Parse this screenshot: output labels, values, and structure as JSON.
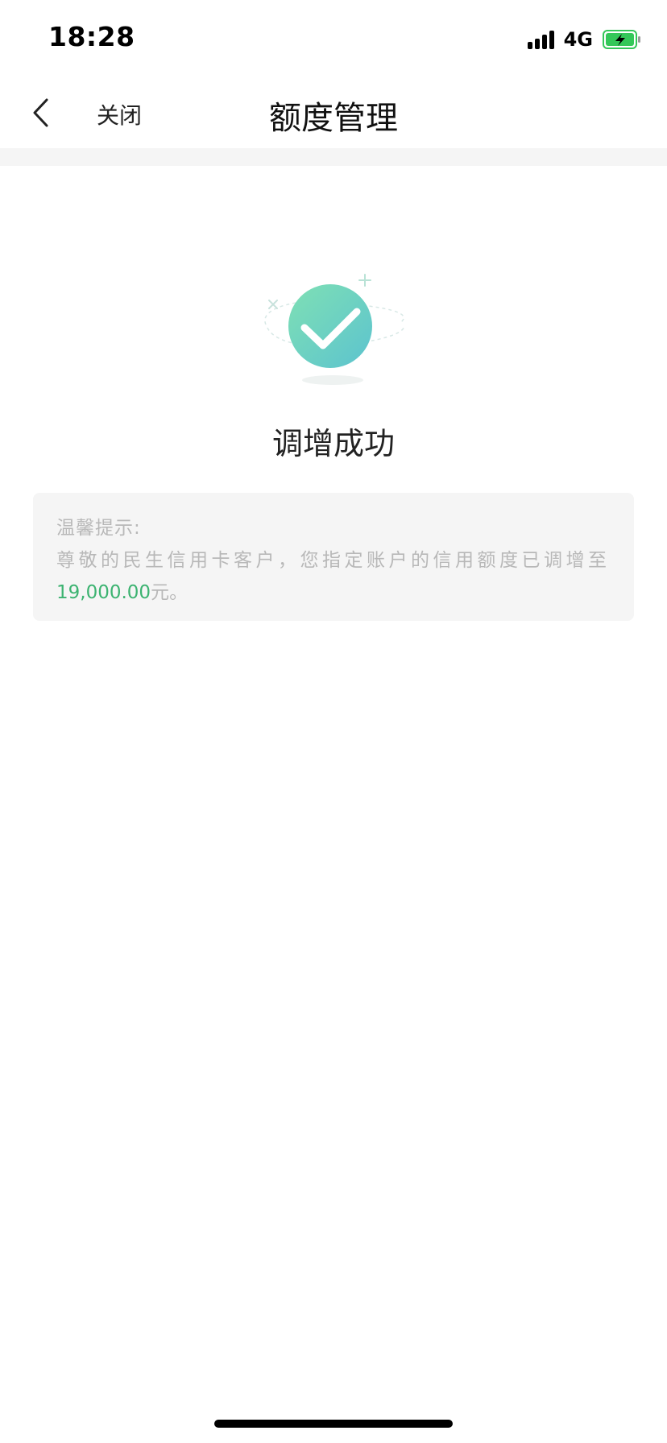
{
  "status_bar": {
    "time": "18:28",
    "network": "4G",
    "signal_icon": "signal-bars-icon",
    "battery_icon": "battery-charging-icon",
    "battery_color": "#34c759"
  },
  "nav": {
    "back_icon": "chevron-left-icon",
    "close_label": "关闭",
    "title": "额度管理"
  },
  "result": {
    "icon": "success-check-icon",
    "accent_color": "#5fcdb7",
    "title": "调增成功"
  },
  "tip": {
    "title": "温馨提示:",
    "body": "尊敬的民生信用卡客户，您指定账户的信用额度已调增至",
    "amount": "19,000.00",
    "unit": "元。",
    "amount_color": "#3cb371"
  }
}
